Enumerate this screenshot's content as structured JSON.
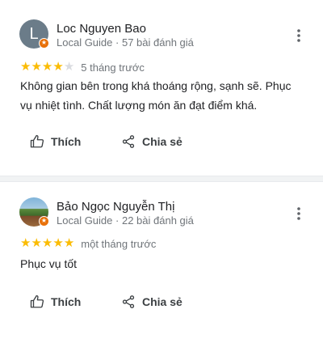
{
  "reviews": [
    {
      "avatar_initial": "L",
      "reviewer_name": "Loc Nguyen Bao",
      "badge": "Local Guide",
      "separator": "·",
      "review_count": "57 bài đánh giá",
      "rating": 4,
      "max_rating": 5,
      "time_ago": "5 tháng trước",
      "text": "Không gian bên trong khá thoáng rộng, sạnh sẽ. Phục vụ nhiệt tình. Chất lượng món ăn đạt điểm khá.",
      "like_label": "Thích",
      "share_label": "Chia sẻ"
    },
    {
      "avatar_initial": "",
      "reviewer_name": "Bảo Ngọc Nguyễn Thị",
      "badge": "Local Guide",
      "separator": "·",
      "review_count": "22 bài đánh giá",
      "rating": 5,
      "max_rating": 5,
      "time_ago": "một tháng trước",
      "text": "Phục vụ tốt",
      "like_label": "Thích",
      "share_label": "Chia sẻ"
    }
  ],
  "colors": {
    "star_filled": "#fbbc04",
    "star_empty": "#dadce0",
    "secondary_text": "#70757a",
    "local_guide_badge": "#e8710a"
  },
  "icons": {
    "more": "more-vert-icon",
    "like": "thumb-up-icon",
    "share": "share-icon",
    "badge": "local-guide-badge-icon"
  }
}
